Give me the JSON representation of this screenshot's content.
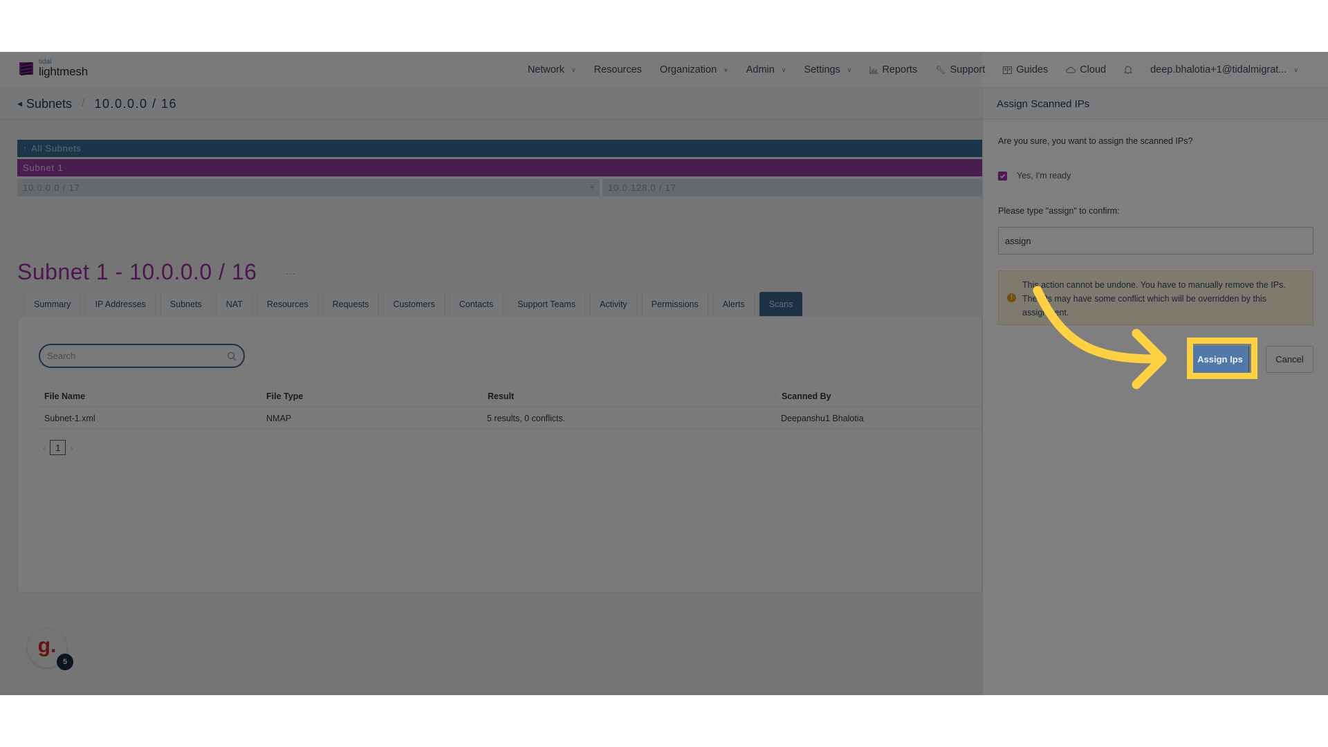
{
  "app": {
    "logo_small": "tidal",
    "logo_big": "lightmesh",
    "brand_color": "#a12fa8"
  },
  "nav": {
    "items": [
      {
        "label": "Network",
        "dropdown": true
      },
      {
        "label": "Resources",
        "dropdown": false
      },
      {
        "label": "Organization",
        "dropdown": true
      },
      {
        "label": "Admin",
        "dropdown": true
      },
      {
        "label": "Settings",
        "dropdown": true
      },
      {
        "label": "Reports",
        "icon": "bar-chart-icon"
      },
      {
        "label": "Support",
        "icon": "wrench-icon"
      },
      {
        "label": "Guides",
        "icon": "book-icon"
      },
      {
        "label": "Cloud",
        "icon": "cloud-icon"
      }
    ],
    "notifications_icon": "bell-icon",
    "user": "deep.bhalotia+1@tidalmigrat..."
  },
  "breadcrumb": {
    "parent": "Subnets",
    "current": "10.0.0.0 / 16"
  },
  "subnet_tree": {
    "root": "All Subnets",
    "selected": "Subnet 1",
    "children": [
      "10.0.0.0 / 17",
      "10.0.128.0 / 17"
    ]
  },
  "page": {
    "title": "Subnet 1 - 10.0.0.0 / 16",
    "more": "···"
  },
  "tabs": [
    {
      "label": "Summary",
      "active": false
    },
    {
      "label": "IP Addresses",
      "active": false
    },
    {
      "label": "Subnets",
      "active": false
    },
    {
      "label": "NAT",
      "active": false
    },
    {
      "label": "Resources",
      "active": false
    },
    {
      "label": "Requests",
      "active": false
    },
    {
      "label": "Customers",
      "active": false
    },
    {
      "label": "Contacts",
      "active": false
    },
    {
      "label": "Support Teams",
      "active": false
    },
    {
      "label": "Activity",
      "active": false
    },
    {
      "label": "Permissions",
      "active": false
    },
    {
      "label": "Alerts",
      "active": false
    },
    {
      "label": "Scans",
      "active": true
    }
  ],
  "scans": {
    "search_placeholder": "Search",
    "columns": [
      "File Name",
      "File Type",
      "Result",
      "Scanned By"
    ],
    "rows": [
      [
        "Subnet-1.xml",
        "NMAP",
        "5 results, 0 conflicts.",
        "Deepanshu1 Bhalotia"
      ]
    ],
    "pagination": {
      "current_page": "1"
    }
  },
  "help_widget": {
    "glyph": "g.",
    "badge": "5"
  },
  "drawer": {
    "title": "Assign Scanned IPs",
    "question": "Are you sure, you want to assign the scanned IPs?",
    "checkbox_label": "Yes, I'm ready",
    "checkbox_checked": true,
    "prompt": "Please type \"assign\" to confirm:",
    "input_value": "assign",
    "warning": "This action cannot be undone. You have to manually remove the IPs. The IPs may have some conflict which will be overridden by this assignment.",
    "warning_icon": "exclamation-circle-icon",
    "assign_button": "Assign Ips",
    "cancel_button": "Cancel"
  },
  "annotation": {
    "highlight_color": "#fed044",
    "target": "Assign Ips"
  }
}
